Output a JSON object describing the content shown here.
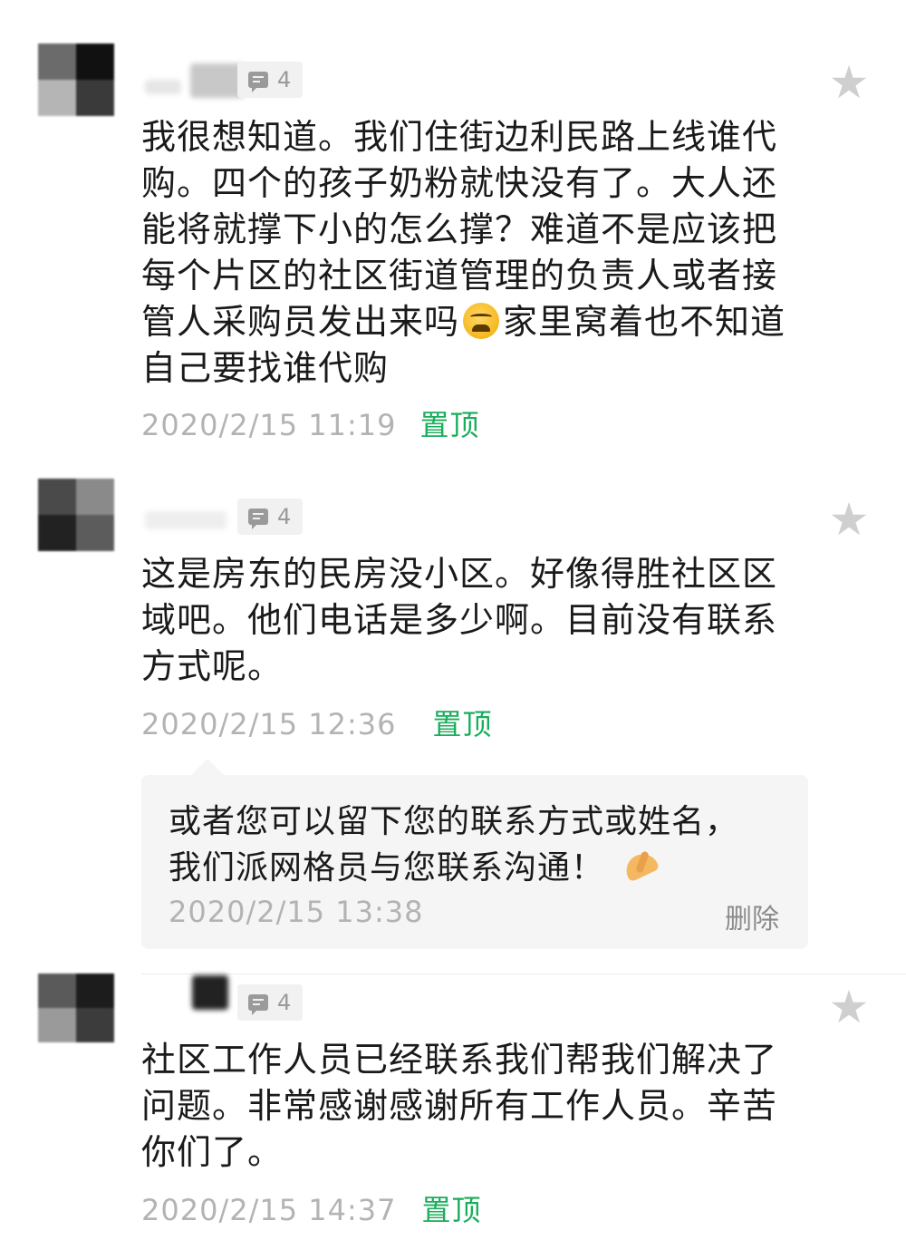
{
  "comments": [
    {
      "like_count": "4",
      "text_lines": [
        "我很想知道。我们住街边利民路上线谁代",
        "购。四个的孩子奶粉就快没有了。大人还",
        "能将就撑下小的怎么撑？难道不是应该把",
        "每个片区的社区街道管理的负责人或者接"
      ],
      "text_line5_before": "管人采购员发出来吗",
      "text_line5_emoji": "crying-laughing-emoji",
      "text_line5_after": "家里窝着也不知道",
      "text_line6": "自己要找谁代购",
      "timestamp": "2020/2/15 11:19",
      "pin_label": "置顶"
    },
    {
      "like_count": "4",
      "text_lines": [
        "这是房东的民房没小区。好像得胜社区区",
        "域吧。他们电话是多少啊。目前没有联系",
        "方式呢。"
      ],
      "timestamp": "2020/2/15 12:36",
      "pin_label": "置顶",
      "reply": {
        "line1": "或者您可以留下您的联系方式或姓名，",
        "line2": "我们派网格员与您联系沟通！",
        "line2_emoji": "hand-icon",
        "timestamp": "2020/2/15 13:38",
        "delete_label": "删除"
      }
    },
    {
      "like_count": "4",
      "text_lines": [
        "社区工作人员已经联系我们帮我们解决了",
        "问题。非常感谢感谢所有工作人员。辛苦",
        "你们了。"
      ],
      "timestamp": "2020/2/15 14:37",
      "pin_label": "置顶"
    }
  ],
  "colors": {
    "pin_green": "#1aad5b",
    "meta_gray": "#b3b3b3",
    "star_gray": "#cfcfcf",
    "reply_bg": "#f5f5f5"
  },
  "icons": {
    "like": "comment-bubble-icon",
    "favorite": "star-icon"
  }
}
